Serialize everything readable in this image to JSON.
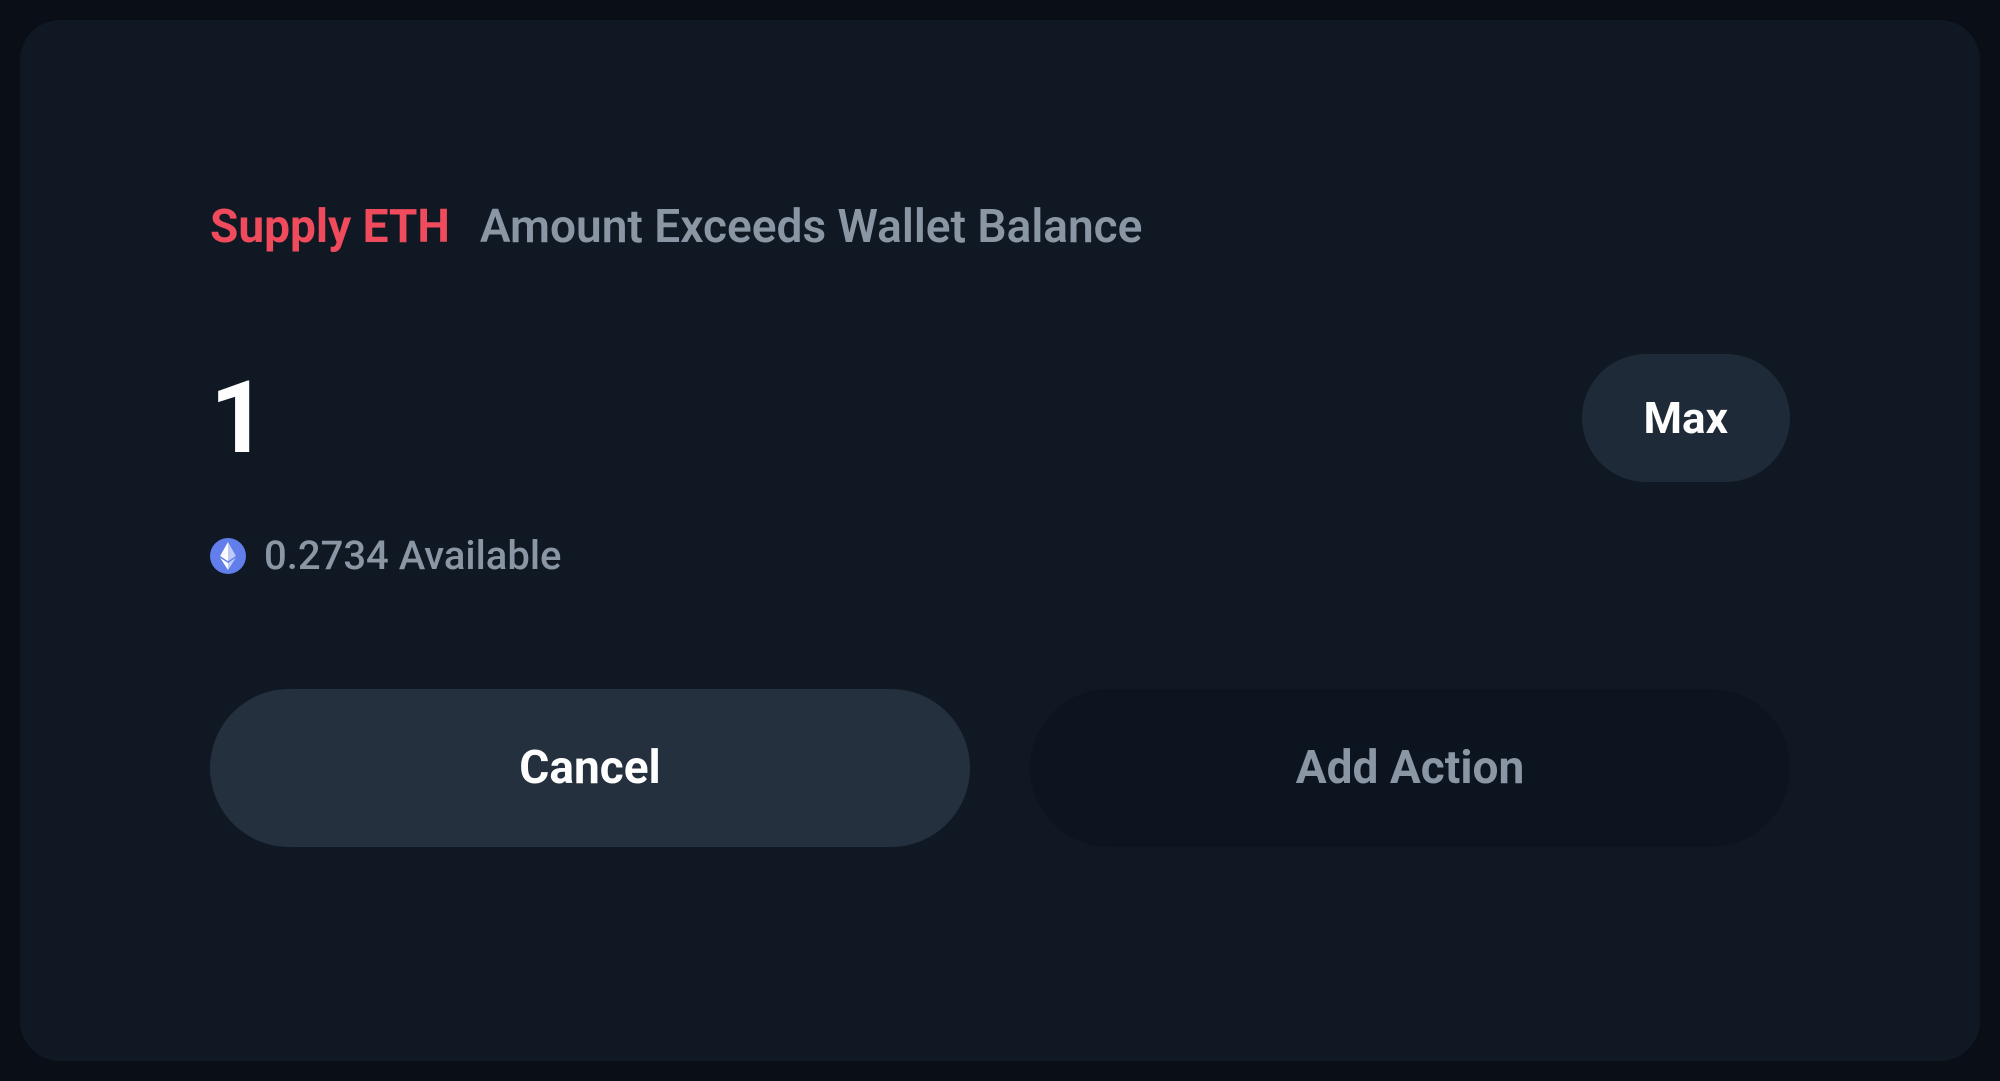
{
  "header": {
    "title": "Supply ETH",
    "warning": "Amount Exceeds Wallet Balance"
  },
  "input": {
    "amount": "1",
    "max_label": "Max"
  },
  "balance": {
    "available_text": "0.2734 Available",
    "token_icon": "ethereum-icon"
  },
  "buttons": {
    "cancel_label": "Cancel",
    "add_action_label": "Add Action"
  }
}
